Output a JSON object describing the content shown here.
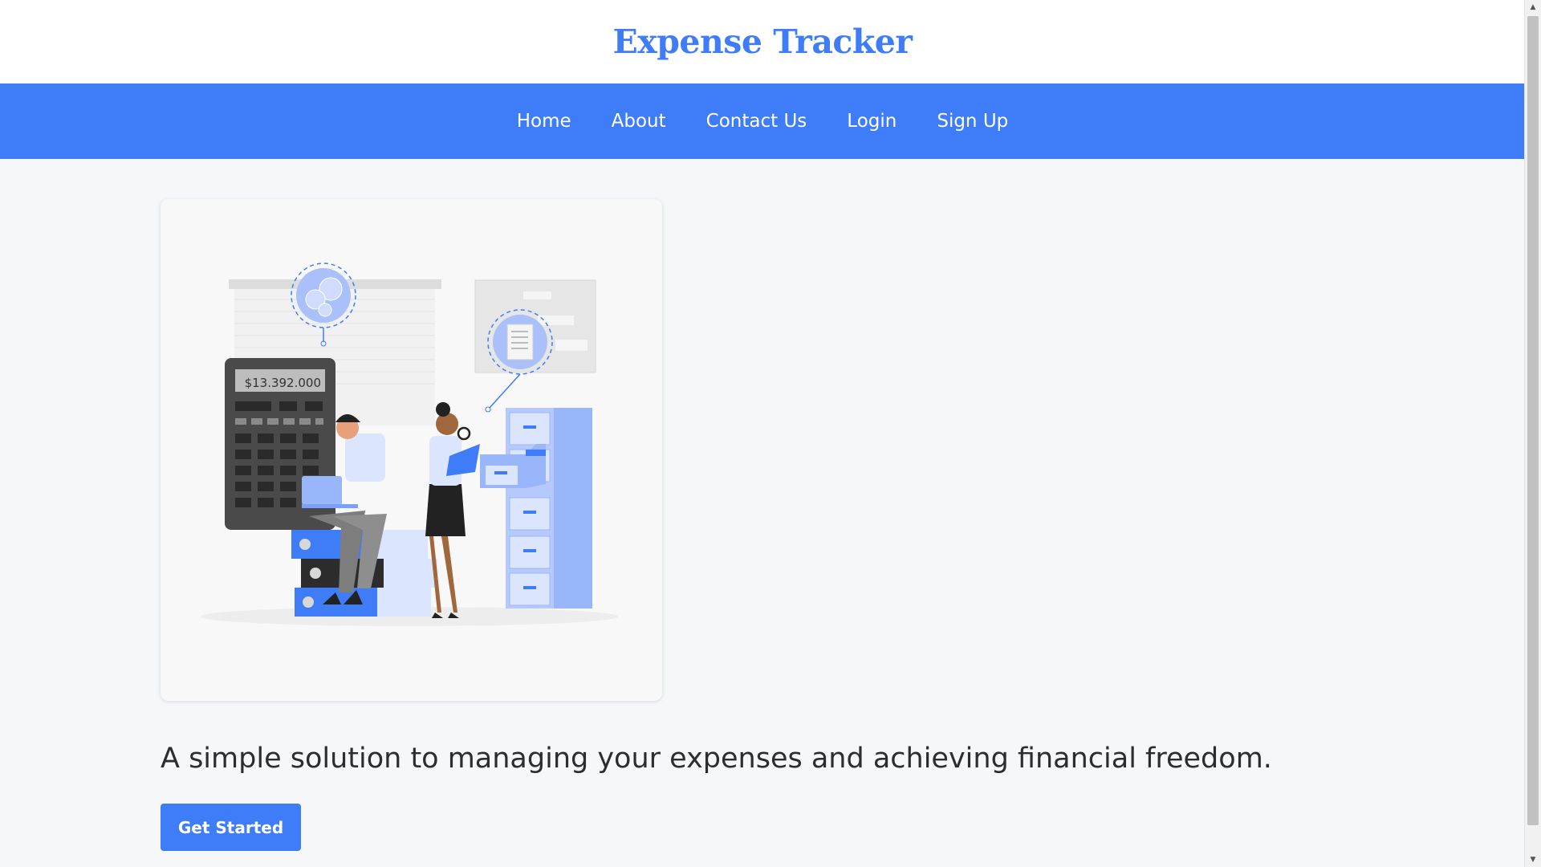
{
  "header": {
    "title": "Expense Tracker"
  },
  "nav": {
    "items": [
      {
        "label": "Home"
      },
      {
        "label": "About"
      },
      {
        "label": "Contact Us"
      },
      {
        "label": "Login"
      },
      {
        "label": "Sign Up"
      }
    ]
  },
  "hero": {
    "illustration": {
      "calculator_display": "$13.392.000"
    },
    "tagline": "A simple solution to managing your expenses and achieving financial freedom.",
    "cta_label": "Get Started"
  },
  "colors": {
    "accent": "#3f7cf8",
    "background": "#f6f7f9",
    "text": "#2d2d2d"
  },
  "scrollbar": {
    "up_icon": "arrow-up-icon",
    "down_icon": "arrow-down-icon"
  }
}
